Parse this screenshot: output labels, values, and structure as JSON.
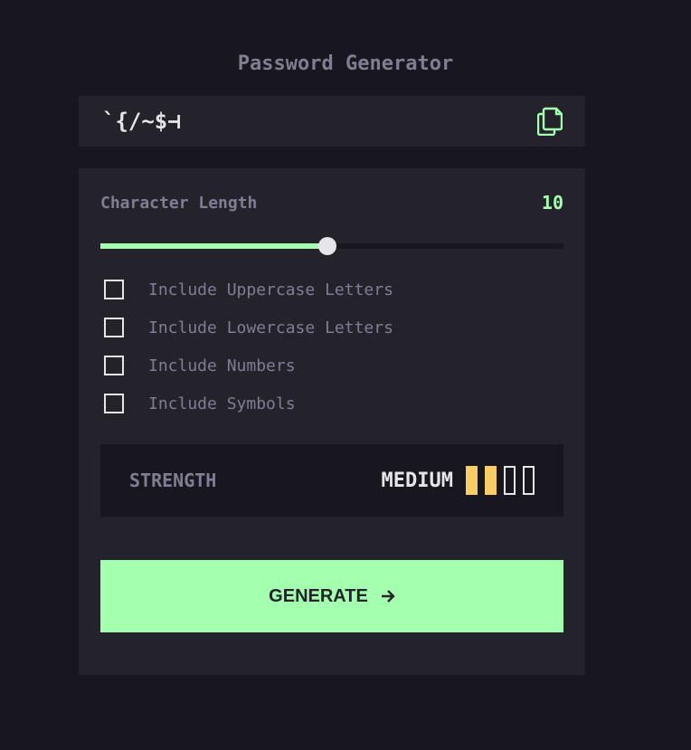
{
  "app": {
    "title": "Password Generator"
  },
  "password": {
    "value": "`{/~$⊣",
    "copy_icon": "copy-icon"
  },
  "length": {
    "label": "Character Length",
    "value": "10",
    "slider_fraction": 0.49
  },
  "options": [
    {
      "label": "Include Uppercase Letters",
      "checked": false
    },
    {
      "label": "Include Lowercase Letters",
      "checked": false
    },
    {
      "label": "Include Numbers",
      "checked": false
    },
    {
      "label": "Include Symbols",
      "checked": false
    }
  ],
  "strength": {
    "label": "STRENGTH",
    "value": "MEDIUM",
    "level": 2,
    "max_level": 4,
    "bar_color": "#f8cd65"
  },
  "generate": {
    "label": "GENERATE",
    "icon": "arrow-right-icon"
  },
  "colors": {
    "background": "#18171f",
    "panel": "#24232c",
    "accent": "#a4ffaf",
    "muted": "#817d92",
    "text": "#e6e5ea"
  }
}
